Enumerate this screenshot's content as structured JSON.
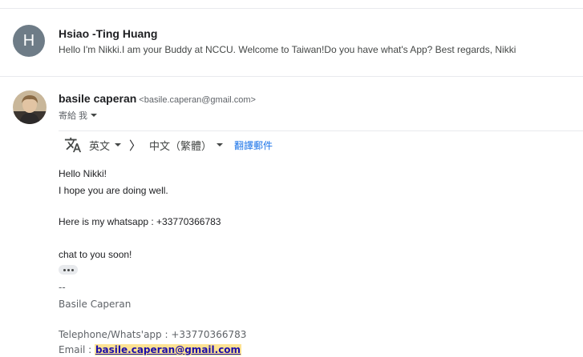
{
  "thread": [
    {
      "avatar_letter": "H",
      "sender": "Hsiao -Ting Huang",
      "snippet": "Hello I'm Nikki.I am your Buddy at NCCU. Welcome to Taiwan!Do you have what's App? Best regards, Nikki"
    }
  ],
  "message": {
    "sender_name": "basile caperan",
    "sender_email": "<basile.caperan@gmail.com>",
    "to_label": "寄給 我"
  },
  "translate": {
    "from_lang": "英文",
    "arrow": "〉",
    "to_lang": "中文（繁體）",
    "translate_link": "翻譯郵件"
  },
  "body": {
    "line1": "Hello Nikki!",
    "line2": "I hope you are doing well.",
    "line3": "Here is my whatsapp : +33770366783",
    "line4": "chat to you soon!"
  },
  "signature": {
    "dashes": "--",
    "name": "Basile Caperan",
    "phone": "Telephone/Whats'app : +33770366783",
    "email_label": "Email : ",
    "email_link": "basile.caperan@gmail.com"
  }
}
